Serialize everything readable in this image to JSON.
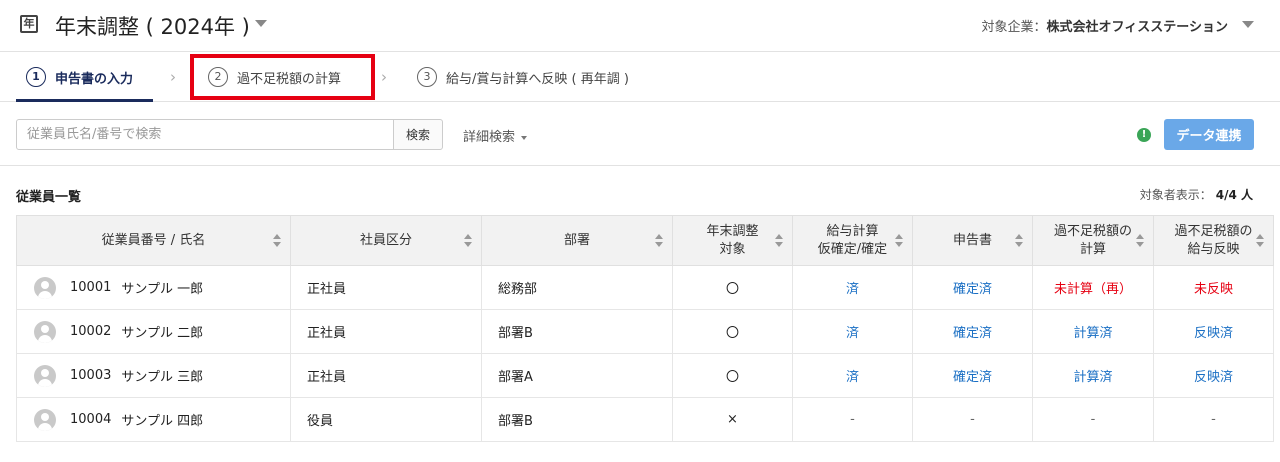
{
  "header": {
    "app_icon": "年",
    "title": "年末調整 ( 2024年 )",
    "company_label": "対象企業：",
    "company_name": "株式会社オフィスステーション"
  },
  "steps": [
    {
      "num": "1",
      "label": "申告書の入力",
      "active": true
    },
    {
      "num": "2",
      "label": "過不足税額の計算",
      "active": false
    },
    {
      "num": "3",
      "label": "給与/賞与計算へ反映 ( 再年調 )",
      "active": false
    }
  ],
  "toolbar": {
    "search_placeholder": "従業員氏名/番号で検索",
    "search_button": "検索",
    "advanced_search": "詳細検索",
    "status_icon": "!",
    "data_button": "データ連携"
  },
  "list": {
    "title": "従業員一覧",
    "count_label": "対象者表示：",
    "count_value": "4/4 人"
  },
  "table": {
    "headers": [
      "従業員番号 / 氏名",
      "社員区分",
      "部署",
      "年末調整\n対象",
      "給与計算\n仮確定/確定",
      "申告書",
      "過不足税額の\n計算",
      "過不足税額の\n給与反映"
    ],
    "rows": [
      {
        "id": "10001",
        "name": "サンプル 一郎",
        "type": "正社員",
        "dept": "総務部",
        "target": "〇",
        "payroll": "済",
        "form": "確定済",
        "calc": "未計算（再）",
        "reflect": "未反映"
      },
      {
        "id": "10002",
        "name": "サンプル 二郎",
        "type": "正社員",
        "dept": "部署B",
        "target": "〇",
        "payroll": "済",
        "form": "確定済",
        "calc": "計算済",
        "reflect": "反映済"
      },
      {
        "id": "10003",
        "name": "サンプル 三郎",
        "type": "正社員",
        "dept": "部署A",
        "target": "〇",
        "payroll": "済",
        "form": "確定済",
        "calc": "計算済",
        "reflect": "反映済"
      },
      {
        "id": "10004",
        "name": "サンプル 四郎",
        "type": "役員",
        "dept": "部署B",
        "target": "×",
        "payroll": "-",
        "form": "-",
        "calc": "-",
        "reflect": "-"
      }
    ]
  },
  "colors": {
    "accent": "#1a2b5c",
    "link": "#1a6fc4",
    "alert": "#e60012",
    "button": "#6aa8e8",
    "status": "#3aa557"
  }
}
